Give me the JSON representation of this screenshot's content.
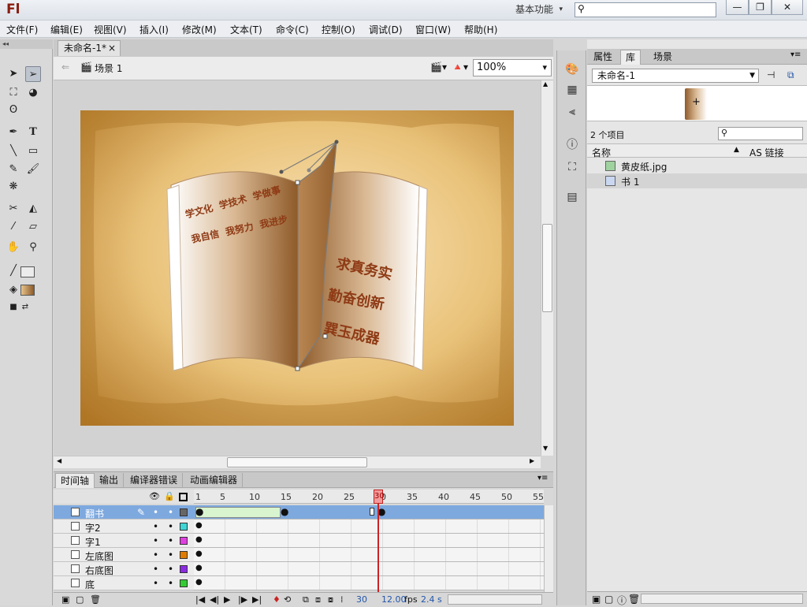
{
  "app": {
    "logo": "Fl",
    "workspace": "基本功能",
    "document_tab": "未命名-1*",
    "scene": "场景 1",
    "zoom": "100%",
    "tab_close": "×"
  },
  "menu": [
    "文件(F)",
    "编辑(E)",
    "视图(V)",
    "插入(I)",
    "修改(M)",
    "文本(T)",
    "命令(C)",
    "控制(O)",
    "调试(D)",
    "窗口(W)",
    "帮助(H)"
  ],
  "window_controls": {
    "minimize": "—",
    "restore": "❐",
    "close": "✕"
  },
  "canvas": {
    "page_text_left": [
      "学文化  学技术  学做事",
      "我自信  我努力  我进步"
    ],
    "page_text_right": [
      "求真务实",
      "勤奋创新",
      "巽玉成器"
    ]
  },
  "timeline": {
    "tabs": [
      "时间轴",
      "输出",
      "编译器错误",
      "动画编辑器"
    ],
    "ruler_ticks": [
      "1",
      "5",
      "10",
      "15",
      "20",
      "25",
      "30",
      "35",
      "40",
      "45",
      "50",
      "55"
    ],
    "current_frame": "30",
    "layers": [
      {
        "name": "翻书",
        "color": "#666666"
      },
      {
        "name": "字2",
        "color": "#3dd6d6"
      },
      {
        "name": "字1",
        "color": "#e040e0"
      },
      {
        "name": "左底图",
        "color": "#e07b00"
      },
      {
        "name": "右底图",
        "color": "#8a2be2"
      },
      {
        "name": "底",
        "color": "#33cc33"
      }
    ],
    "footer": {
      "frame": "30",
      "fps": "12.00",
      "fps_unit": "fps",
      "time": "2.4 s"
    }
  },
  "library": {
    "tabs": [
      "属性",
      "库",
      "场景"
    ],
    "document": "未命名-1",
    "count": "2 个项目",
    "col_name": "名称",
    "col_link": "AS 链接",
    "items": [
      {
        "name": "黄皮纸.jpg",
        "icon": "bitmap-icon"
      },
      {
        "name": "书 1",
        "icon": "graphic-symbol-icon"
      }
    ]
  },
  "colors": {
    "accent": "#7ea9df",
    "playhead": "#cc2222",
    "brand": "#8a1d0f"
  }
}
